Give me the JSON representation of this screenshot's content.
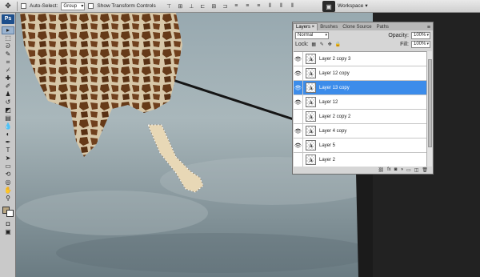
{
  "options_bar": {
    "move_tool_icon": "move-tool-icon",
    "auto_select_label": "Auto-Select:",
    "auto_select_value": "Group",
    "show_transform_label": "Show Transform Controls",
    "align_icons": [
      "align-top",
      "align-vcenter",
      "align-bottom",
      "align-left",
      "align-hcenter",
      "align-right",
      "distribute-top",
      "distribute-vcenter",
      "distribute-bottom",
      "distribute-left",
      "distribute-hcenter",
      "distribute-right"
    ],
    "workspace_label": "Workspace"
  },
  "toolbox": {
    "logo": "Ps",
    "tools": [
      "move",
      "marquee",
      "lasso",
      "quick-select",
      "crop",
      "eyedropper",
      "healing",
      "brush",
      "clone-stamp",
      "history-brush",
      "eraser",
      "gradient",
      "blur",
      "dodge",
      "pen",
      "type",
      "path-select",
      "shape",
      "3d-rotate",
      "3d-orbit",
      "hand",
      "zoom"
    ],
    "foreground_color": "#b8a581",
    "background_color": "#ffffff"
  },
  "layers_panel": {
    "tabs": [
      "Layers ×",
      "Brushes",
      "Clone Source",
      "Paths"
    ],
    "blend_mode": "Normal",
    "opacity_label": "Opacity:",
    "opacity_value": "100%",
    "lock_label": "Lock:",
    "fill_label": "Fill:",
    "fill_value": "100%",
    "layers": [
      {
        "name": "Layer 2 copy 3",
        "visible": true,
        "selected": false
      },
      {
        "name": "Layer 12 copy",
        "visible": true,
        "selected": false
      },
      {
        "name": "Layer 13 copy",
        "visible": true,
        "selected": true
      },
      {
        "name": "Layer 12",
        "visible": true,
        "selected": false
      },
      {
        "name": "Layer 2 copy 2",
        "visible": false,
        "selected": false
      },
      {
        "name": "Layer 4 copy",
        "visible": true,
        "selected": false
      },
      {
        "name": "Layer 5",
        "visible": true,
        "selected": false
      },
      {
        "name": "Layer 2",
        "visible": false,
        "selected": false
      }
    ]
  },
  "colors": {
    "selection_blue": "#3c8cea",
    "ps_logo_blue": "#1d4f8c"
  }
}
